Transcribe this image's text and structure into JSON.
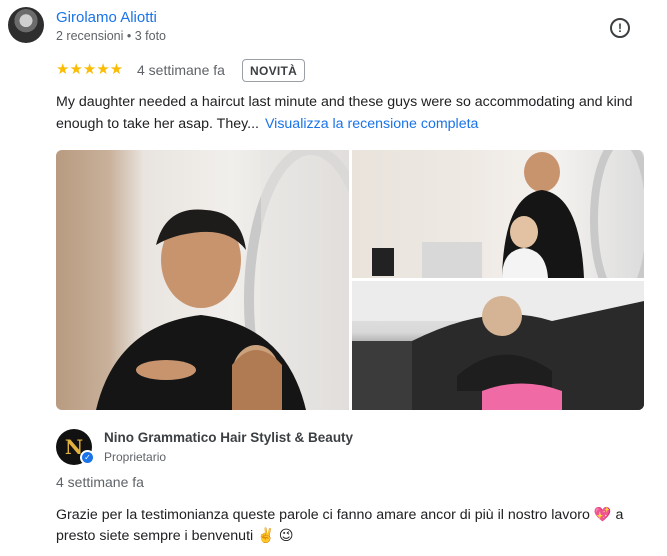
{
  "review": {
    "author": "Girolamo Aliotti",
    "meta": "2 recensioni • 3 foto",
    "rating_stars": "★★★★★",
    "rating": 5,
    "time": "4 settimane fa",
    "badge": "NOVITÀ",
    "text": "My daughter needed a haircut last minute and these guys were so accommodating and kind enough to take her asap. They...",
    "more_link": "Visualizza la recensione completa"
  },
  "owner_reply": {
    "name": "Nino Grammatico Hair Stylist & Beauty",
    "role": "Proprietario",
    "avatar_letter": "N",
    "time": "4 settimane fa",
    "text": "Grazie per la testimonianza queste parole ci fanno amare ancor di più il nostro lavoro 💖 a presto siete sempre i benvenuti ✌️ 😉"
  },
  "colors": {
    "link": "#1a73e8",
    "star": "#fbbc04",
    "owner_logo": "#e2b33c"
  },
  "icons": {
    "report": "report-icon",
    "verified": "verified-badge-icon"
  }
}
